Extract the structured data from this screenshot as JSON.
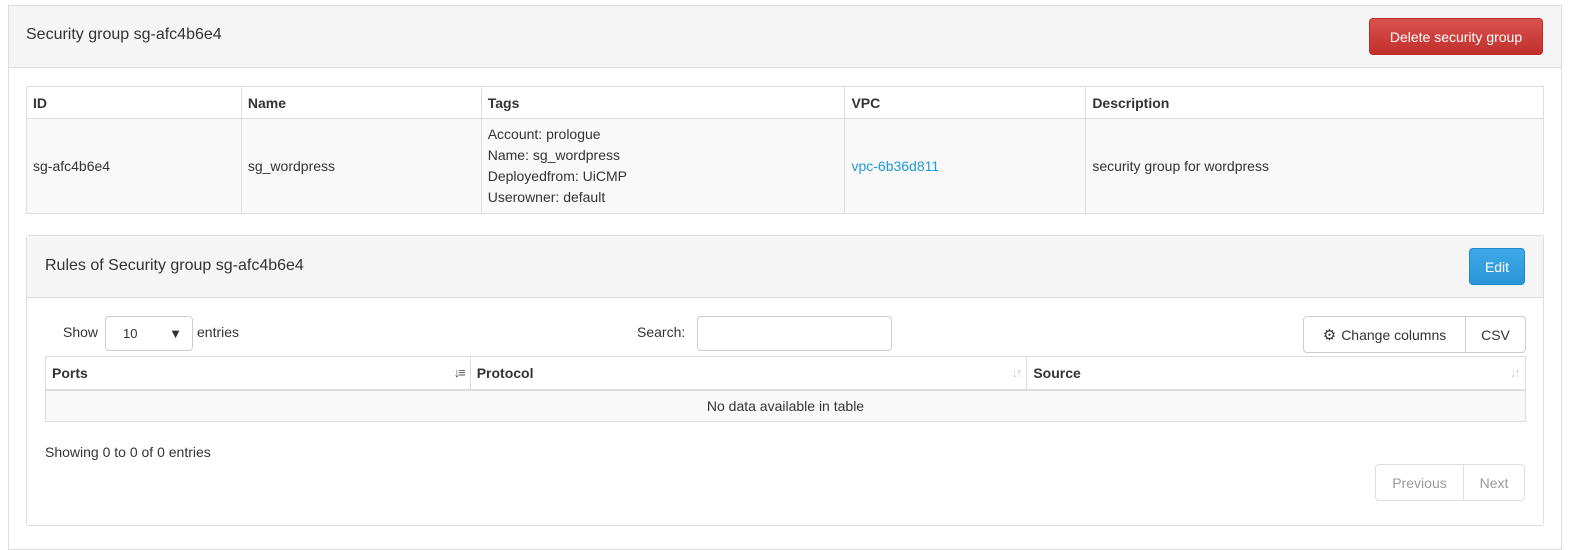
{
  "header": {
    "title": "Security group sg-afc4b6e4",
    "delete_label": "Delete security group"
  },
  "details_table": {
    "columns": [
      "ID",
      "Name",
      "Tags",
      "VPC",
      "Description"
    ],
    "row": {
      "id": "sg-afc4b6e4",
      "name": "sg_wordpress",
      "tags": [
        "Account: prologue",
        "Name: sg_wordpress",
        "Deployedfrom: UiCMP",
        "Userowner: default"
      ],
      "vpc": "vpc-6b36d811",
      "description": "security group for wordpress"
    }
  },
  "rules_panel": {
    "title": "Rules of Security group sg-afc4b6e4",
    "edit_label": "Edit",
    "show_label": "Show",
    "entries_value": "10",
    "entries_label": "entries",
    "search_label": "Search:",
    "search_value": "",
    "change_columns_label": "Change columns",
    "csv_label": "CSV",
    "columns": [
      "Ports",
      "Protocol",
      "Source"
    ],
    "empty_message": "No data available in table",
    "info": "Showing 0 to 0 of 0 entries",
    "previous_label": "Previous",
    "next_label": "Next"
  },
  "icons": {
    "gear": "gear-icon",
    "sort_active": "sort-amount-icon",
    "sort": "sort-icon",
    "dropdown": "caret-down-icon"
  },
  "colors": {
    "danger": "#d9534f",
    "primary": "#2a95d8",
    "link": "#1e9ad6"
  }
}
